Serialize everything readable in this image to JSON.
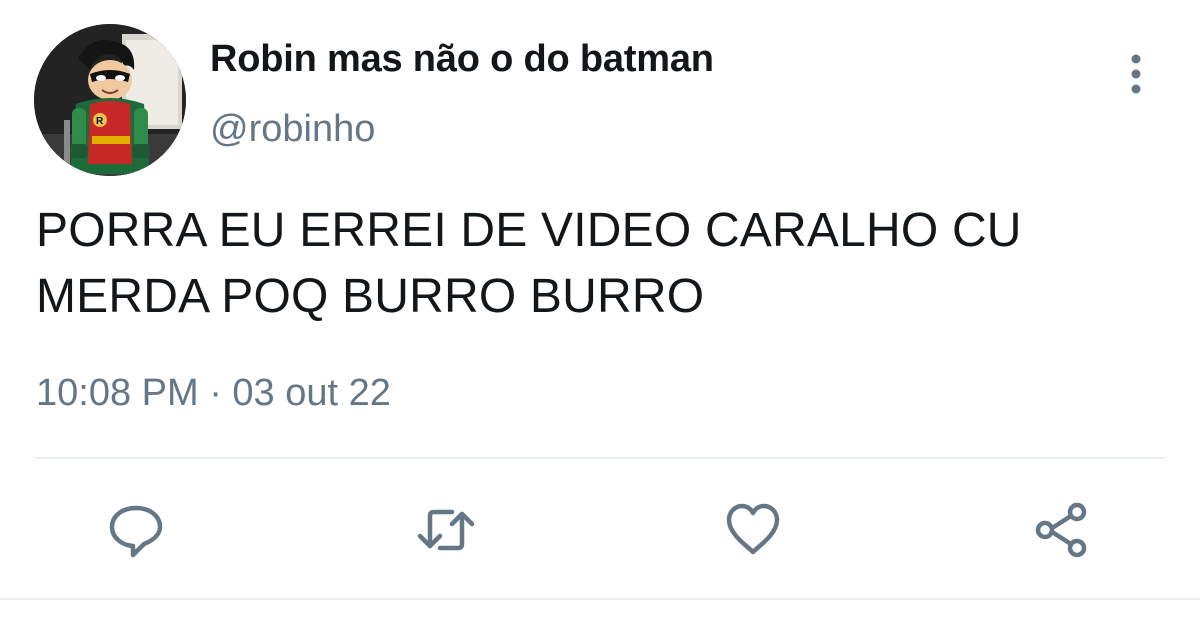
{
  "tweet": {
    "author": {
      "display_name": "Robin mas não o do batman",
      "handle": "@robinho"
    },
    "text": "PORRA EU ERREI DE VIDEO CARALHO CU MERDA POQ BURRO BURRO",
    "timestamp": "10:08 PM · 03 out 22"
  },
  "actions": [
    {
      "icon": "reply-icon"
    },
    {
      "icon": "retweet-icon"
    },
    {
      "icon": "like-icon"
    },
    {
      "icon": "share-icon"
    }
  ],
  "menu": {
    "icon": "more-vertical-icon"
  },
  "colors": {
    "text_primary": "#14171a",
    "text_secondary": "#657786",
    "icon": "#657786",
    "divider": "#e6ecf0"
  }
}
